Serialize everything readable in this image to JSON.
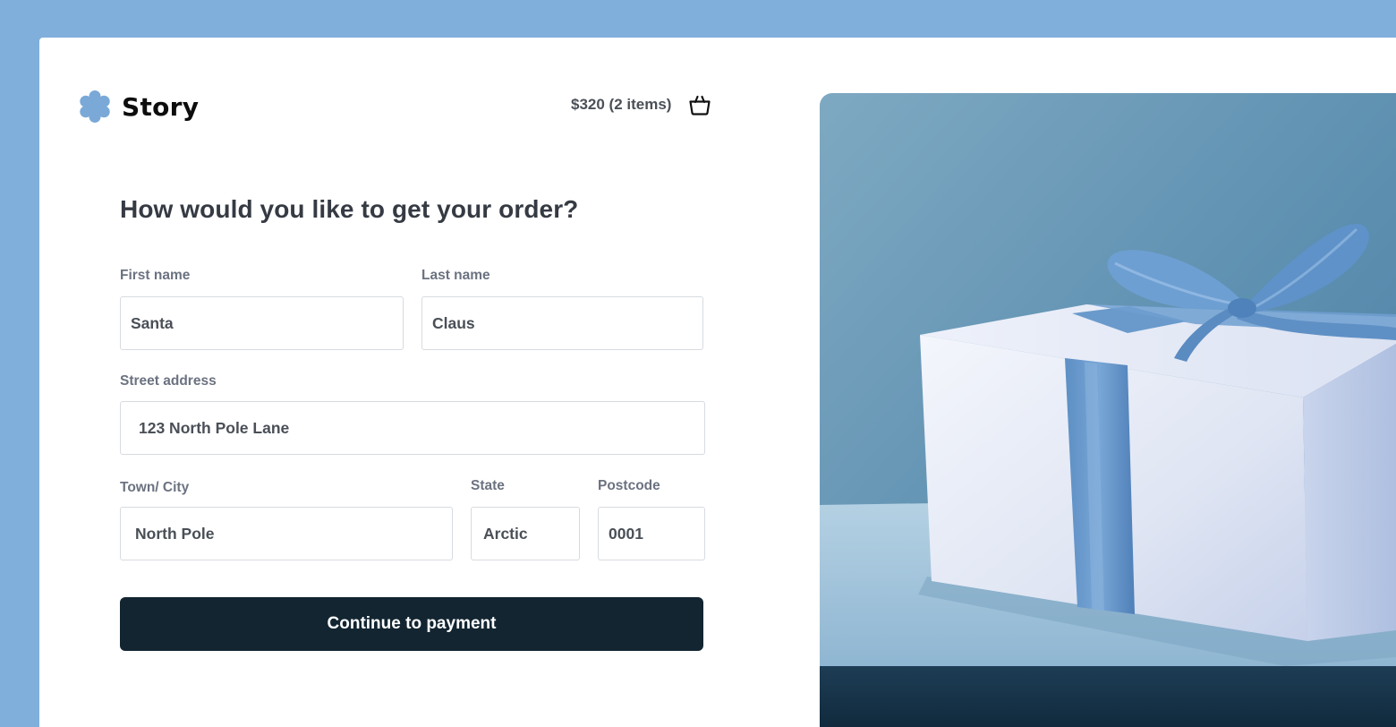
{
  "brand": {
    "name": "Story",
    "logo_icon": "flower-badge-icon",
    "accent_color": "#80afdb"
  },
  "cart": {
    "summary": "$320 (2 items)",
    "icon": "shopping-basket-icon"
  },
  "form": {
    "title": "How would you like to get your order?",
    "first_name": {
      "label": "First name",
      "value": "Santa"
    },
    "last_name": {
      "label": "Last name",
      "value": "Claus"
    },
    "street": {
      "label": "Street address",
      "value": "123 North Pole Lane"
    },
    "city": {
      "label": "Town/ City",
      "value": "North Pole"
    },
    "state": {
      "label": "State",
      "value": "Arctic"
    },
    "postcode": {
      "label": "Postcode",
      "value": "0001"
    },
    "submit_label": "Continue to payment",
    "button_color": "#122531"
  },
  "hero": {
    "subject": "gift-box-with-blue-ribbon"
  }
}
